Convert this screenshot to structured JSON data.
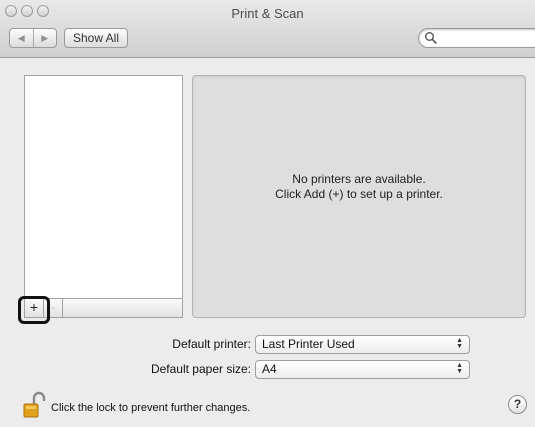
{
  "window": {
    "title": "Print & Scan"
  },
  "toolbar": {
    "back_glyph": "◀",
    "forward_glyph": "▶",
    "show_all_label": "Show All",
    "search_placeholder": ""
  },
  "printer_list": {
    "add_glyph": "+",
    "remove_glyph": "-"
  },
  "detail": {
    "empty_line1": "No printers are available.",
    "empty_line2": "Click Add (+) to set up a printer."
  },
  "defaults": {
    "printer_label": "Default printer:",
    "printer_value": "Last Printer Used",
    "paper_label": "Default paper size:",
    "paper_value": "A4"
  },
  "footer": {
    "lock_text": "Click the lock to prevent further changes.",
    "help_glyph": "?"
  },
  "colors": {
    "window_bg": "#ececec",
    "panel_bg": "#dedede",
    "lock_gold": "#e0a21c"
  },
  "icons": [
    "search-icon",
    "lock-icon",
    "help-icon",
    "back-arrow-icon",
    "forward-arrow-icon"
  ]
}
